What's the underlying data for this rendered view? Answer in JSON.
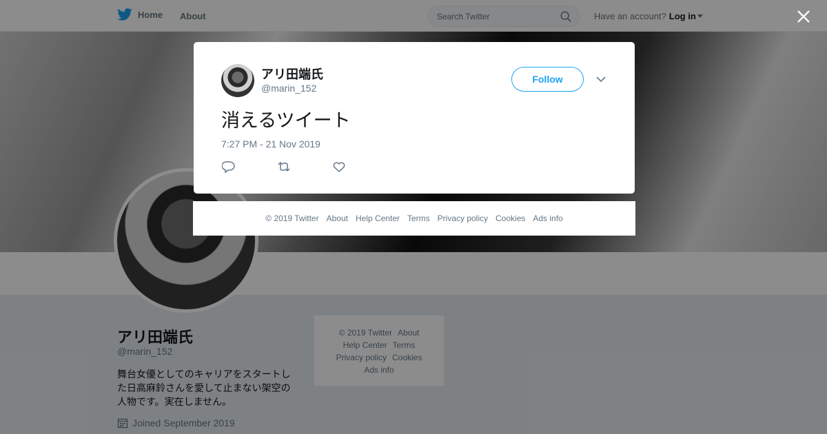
{
  "nav": {
    "home_label": "Home",
    "about_label": "About",
    "search_placeholder": "Search Twitter",
    "account_prompt": "Have an account?",
    "login_label": "Log in"
  },
  "profile": {
    "name": "アリ田端氏",
    "handle": "@marin_152",
    "bio": "舞台女優としてのキャリアをスタートした日高麻鈴さんを愛して止まない架空の人物です。実在しません。",
    "joined": "Joined September 2019"
  },
  "side_footer": {
    "copyright": "© 2019 Twitter",
    "about": "About",
    "help": "Help Center",
    "terms": "Terms",
    "privacy": "Privacy policy",
    "cookies": "Cookies",
    "ads": "Ads info"
  },
  "tweet": {
    "name": "アリ田端氏",
    "handle": "@marin_152",
    "follow_label": "Follow",
    "text": "消えるツイート",
    "timestamp": "7:27 PM - 21 Nov 2019"
  },
  "modal_footer": {
    "copyright": "© 2019 Twitter",
    "about": "About",
    "help": "Help Center",
    "terms": "Terms",
    "privacy": "Privacy policy",
    "cookies": "Cookies",
    "ads": "Ads info"
  },
  "icons": {
    "brand": "twitter-bird-icon",
    "search": "search-icon",
    "close": "close-icon",
    "caret": "caret-down-icon",
    "chevron": "chevron-down-icon",
    "reply": "reply-icon",
    "retweet": "retweet-icon",
    "like": "heart-icon",
    "calendar": "calendar-icon"
  },
  "colors": {
    "brand_blue": "#1da1f2",
    "secondary_text": "#657786",
    "overlay": "rgba(0,0,0,0.45)"
  }
}
